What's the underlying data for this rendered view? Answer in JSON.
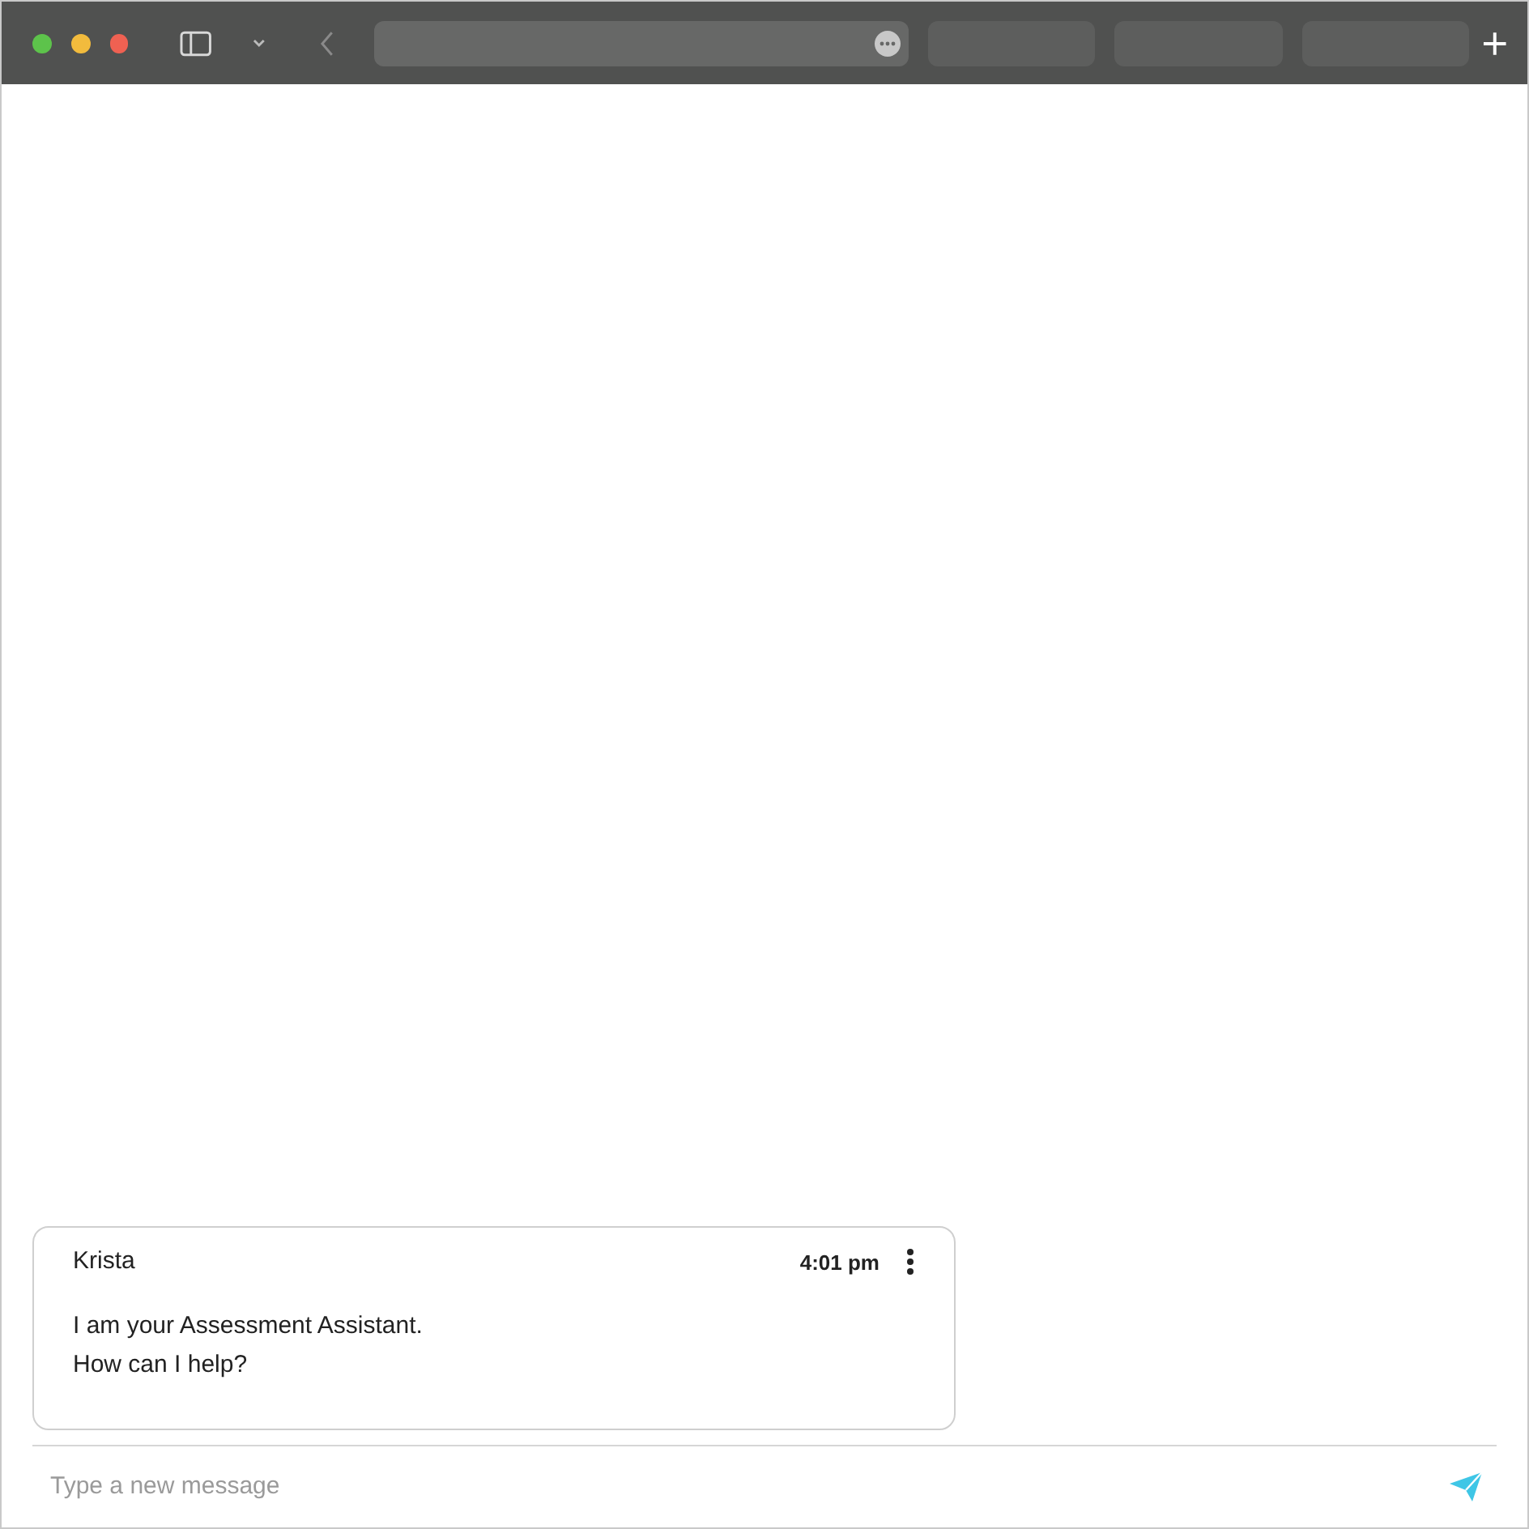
{
  "message": {
    "sender": "Krista",
    "time": "4:01 pm",
    "lines": [
      "I am your Assessment Assistant.",
      "How can I help?"
    ]
  },
  "composer": {
    "placeholder": "Type a new message"
  }
}
